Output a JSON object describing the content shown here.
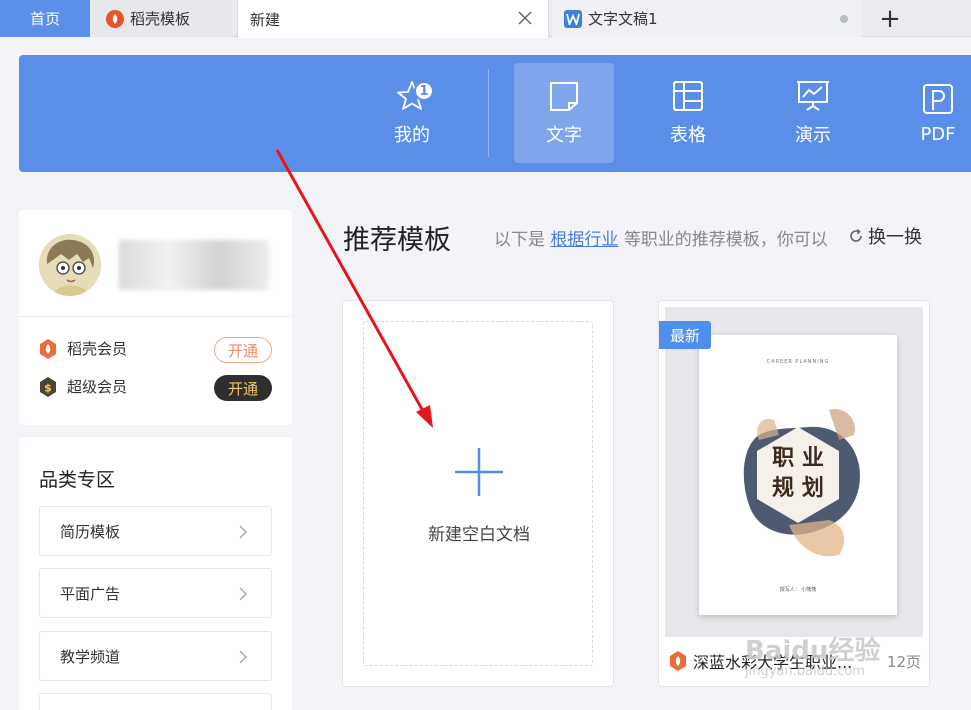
{
  "tabs": [
    {
      "label": "首页"
    },
    {
      "label": "稻壳模板"
    },
    {
      "label": "新建"
    },
    {
      "label": "文字文稿1"
    }
  ],
  "tab_add_label": "+",
  "toolbar": {
    "items": [
      {
        "label": "我的",
        "icon": "star-icon",
        "badge": "1"
      },
      {
        "label": "文字",
        "icon": "document-icon"
      },
      {
        "label": "表格",
        "icon": "table-icon"
      },
      {
        "label": "演示",
        "icon": "presentation-icon"
      },
      {
        "label": "PDF",
        "icon": "pdf-icon"
      }
    ],
    "active": "文字"
  },
  "profile": {
    "vip": [
      {
        "label": "稻壳会员",
        "button": "开通"
      },
      {
        "label": "超级会员",
        "button": "开通"
      }
    ]
  },
  "category": {
    "title": "品类专区",
    "items": [
      {
        "label": "简历模板"
      },
      {
        "label": "平面广告"
      },
      {
        "label": "教学频道"
      }
    ]
  },
  "main": {
    "title": "推荐模板",
    "subtitle_prefix": "以下是",
    "subtitle_link": "根据行业",
    "subtitle_suffix": "等职业的推荐模板，你可以",
    "refresh_label": "换一换"
  },
  "blank_card": {
    "label": "新建空白文档"
  },
  "template_card": {
    "tag": "最新",
    "name": "深蓝水彩大学生职业...",
    "pages": "12页",
    "cover_top_text": "CAREER PLANNING",
    "cover_title_line1": "职 业",
    "cover_title_line2": "规 划",
    "cover_author": "撰写人：  小熊熊"
  },
  "watermark": {
    "main": "Baidu经验",
    "sub": "jingyan.baidu.com"
  },
  "colors": {
    "accent": "#5b8ee8",
    "annotation_arrow": "#e8141c"
  }
}
